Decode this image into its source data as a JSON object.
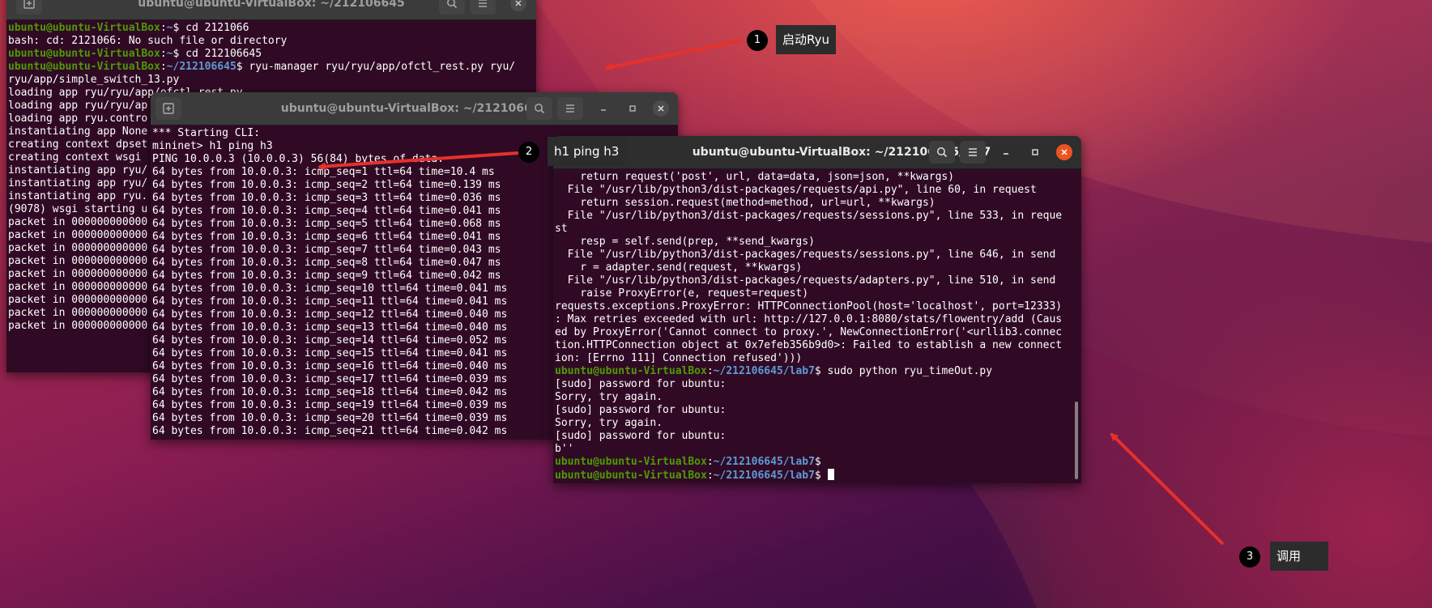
{
  "term_back": {
    "title": "ubuntu@ubuntu-VirtualBox: ~/212106645",
    "lines": [
      {
        "user": "ubuntu@ubuntu-VirtualBox",
        "path": "~",
        "rest": "$ cd 2121066"
      },
      {
        "text": "bash: cd: 2121066: No such file or directory"
      },
      {
        "user": "ubuntu@ubuntu-VirtualBox",
        "path": "~",
        "rest": "$ cd 212106645"
      },
      {
        "user": "ubuntu@ubuntu-VirtualBox",
        "path": "~/212106645",
        "rest": "$ ryu-manager ryu/ryu/app/ofctl_rest.py ryu/"
      },
      {
        "text": "ryu/app/simple_switch_13.py"
      },
      {
        "text": "loading app ryu/ryu/app/ofctl_rest.py"
      },
      {
        "text": "loading app ryu/ryu/ap"
      },
      {
        "text": "loading app ryu.contro"
      },
      {
        "text": "instantiating app None"
      },
      {
        "text": "creating context dpset"
      },
      {
        "text": "creating context wsgi"
      },
      {
        "text": "instantiating app ryu/"
      },
      {
        "text": "instantiating app ryu/"
      },
      {
        "text": "instantiating app ryu."
      },
      {
        "text": "(9078) wsgi starting u"
      },
      {
        "text": "packet in 000000000000"
      },
      {
        "text": "packet in 000000000000"
      },
      {
        "text": "packet in 000000000000"
      },
      {
        "text": "packet in 000000000000"
      },
      {
        "text": "packet in 000000000000"
      },
      {
        "text": "packet in 000000000000"
      },
      {
        "text": "packet in 000000000000"
      },
      {
        "text": "packet in 000000000000"
      },
      {
        "text": "packet in 000000000000"
      }
    ]
  },
  "term_mid": {
    "title": "ubuntu@ubuntu-VirtualBox: ~/212106645",
    "lines": [
      "*** Starting CLI:",
      "mininet> h1 ping h3",
      "PING 10.0.0.3 (10.0.0.3) 56(84) bytes of data.",
      "64 bytes from 10.0.0.3: icmp_seq=1 ttl=64 time=10.4 ms",
      "64 bytes from 10.0.0.3: icmp_seq=2 ttl=64 time=0.139 ms",
      "64 bytes from 10.0.0.3: icmp_seq=3 ttl=64 time=0.036 ms",
      "64 bytes from 10.0.0.3: icmp_seq=4 ttl=64 time=0.041 ms",
      "64 bytes from 10.0.0.3: icmp_seq=5 ttl=64 time=0.068 ms",
      "64 bytes from 10.0.0.3: icmp_seq=6 ttl=64 time=0.041 ms",
      "64 bytes from 10.0.0.3: icmp_seq=7 ttl=64 time=0.043 ms",
      "64 bytes from 10.0.0.3: icmp_seq=8 ttl=64 time=0.047 ms",
      "64 bytes from 10.0.0.3: icmp_seq=9 ttl=64 time=0.042 ms",
      "64 bytes from 10.0.0.3: icmp_seq=10 ttl=64 time=0.041 ms",
      "64 bytes from 10.0.0.3: icmp_seq=11 ttl=64 time=0.041 ms",
      "64 bytes from 10.0.0.3: icmp_seq=12 ttl=64 time=0.040 ms",
      "64 bytes from 10.0.0.3: icmp_seq=13 ttl=64 time=0.040 ms",
      "64 bytes from 10.0.0.3: icmp_seq=14 ttl=64 time=0.052 ms",
      "64 bytes from 10.0.0.3: icmp_seq=15 ttl=64 time=0.041 ms",
      "64 bytes from 10.0.0.3: icmp_seq=16 ttl=64 time=0.040 ms",
      "64 bytes from 10.0.0.3: icmp_seq=17 ttl=64 time=0.039 ms",
      "64 bytes from 10.0.0.3: icmp_seq=18 ttl=64 time=0.042 ms",
      "64 bytes from 10.0.0.3: icmp_seq=19 ttl=64 time=0.039 ms",
      "64 bytes from 10.0.0.3: icmp_seq=20 ttl=64 time=0.039 ms",
      "64 bytes from 10.0.0.3: icmp_seq=21 ttl=64 time=0.042 ms"
    ]
  },
  "term_front": {
    "title": "ubuntu@ubuntu-VirtualBox: ~/212106645/lab7",
    "lines": [
      {
        "text": "    return request('post', url, data=data, json=json, **kwargs)"
      },
      {
        "text": "  File \"/usr/lib/python3/dist-packages/requests/api.py\", line 60, in request"
      },
      {
        "text": "    return session.request(method=method, url=url, **kwargs)"
      },
      {
        "text": "  File \"/usr/lib/python3/dist-packages/requests/sessions.py\", line 533, in reque"
      },
      {
        "text": "st"
      },
      {
        "text": "    resp = self.send(prep, **send_kwargs)"
      },
      {
        "text": "  File \"/usr/lib/python3/dist-packages/requests/sessions.py\", line 646, in send"
      },
      {
        "text": "    r = adapter.send(request, **kwargs)"
      },
      {
        "text": "  File \"/usr/lib/python3/dist-packages/requests/adapters.py\", line 510, in send"
      },
      {
        "text": "    raise ProxyError(e, request=request)"
      },
      {
        "text": "requests.exceptions.ProxyError: HTTPConnectionPool(host='localhost', port=12333)"
      },
      {
        "text": ": Max retries exceeded with url: http://127.0.0.1:8080/stats/flowentry/add (Caus"
      },
      {
        "text": "ed by ProxyError('Cannot connect to proxy.', NewConnectionError('<urllib3.connec"
      },
      {
        "text": "tion.HTTPConnection object at 0x7efeb356b9d0>: Failed to establish a new connect"
      },
      {
        "text": "ion: [Errno 111] Connection refused')))"
      },
      {
        "user": "ubuntu@ubuntu-VirtualBox",
        "path": "~/212106645/lab7",
        "rest": "$ sudo python ryu_timeOut.py"
      },
      {
        "text": "[sudo] password for ubuntu:"
      },
      {
        "text": "Sorry, try again."
      },
      {
        "text": "[sudo] password for ubuntu:"
      },
      {
        "text": "Sorry, try again."
      },
      {
        "text": "[sudo] password for ubuntu:"
      },
      {
        "text": "b''"
      },
      {
        "user": "ubuntu@ubuntu-VirtualBox",
        "path": "~/212106645/lab7",
        "rest": "$"
      },
      {
        "user": "ubuntu@ubuntu-VirtualBox",
        "path": "~/212106645/lab7",
        "rest": "$ ",
        "cursor": true
      }
    ]
  },
  "annotations": [
    {
      "num": "1",
      "label": "启动Ryu"
    },
    {
      "num": "2",
      "label": "h1 ping h3"
    },
    {
      "num": "3",
      "label": "调用"
    }
  ],
  "colors": {
    "arrow": "#e8302a",
    "accent": "#e95420",
    "terminal_bg": "#300a24"
  }
}
